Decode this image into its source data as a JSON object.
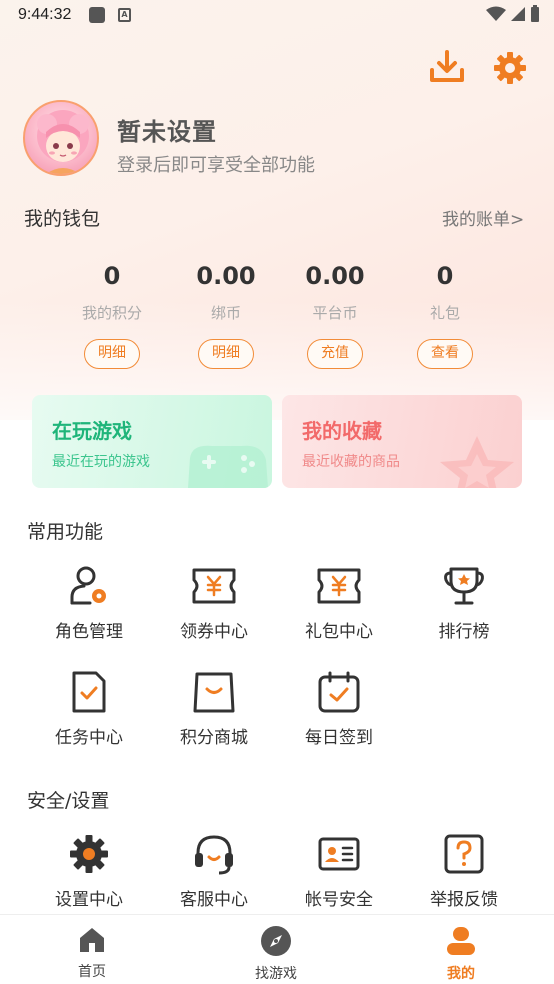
{
  "status_bar": {
    "time": "9:44:32"
  },
  "profile": {
    "name": "暂未设置",
    "subtitle": "登录后即可享受全部功能"
  },
  "wallet": {
    "title": "我的钱包",
    "link": "我的账单>",
    "items": [
      {
        "value": "0",
        "label": "我的积分",
        "button": "明细"
      },
      {
        "value": "0.00",
        "label": "绑币",
        "button": "明细"
      },
      {
        "value": "0.00",
        "label": "平台币",
        "button": "充值"
      },
      {
        "value": "0",
        "label": "礼包",
        "button": "查看"
      }
    ]
  },
  "cards": [
    {
      "title": "在玩游戏",
      "subtitle": "最近在玩的游戏"
    },
    {
      "title": "我的收藏",
      "subtitle": "最近收藏的商品"
    }
  ],
  "common": {
    "title": "常用功能",
    "items": [
      {
        "label": "角色管理",
        "icon": "role-manage-icon"
      },
      {
        "label": "领券中心",
        "icon": "coupon-icon"
      },
      {
        "label": "礼包中心",
        "icon": "gift-ticket-icon"
      },
      {
        "label": "排行榜",
        "icon": "trophy-icon"
      },
      {
        "label": "任务中心",
        "icon": "task-icon"
      },
      {
        "label": "积分商城",
        "icon": "shopping-bag-icon"
      },
      {
        "label": "每日签到",
        "icon": "calendar-check-icon"
      }
    ]
  },
  "security": {
    "title": "安全/设置",
    "items": [
      {
        "label": "设置中心",
        "icon": "gear-icon"
      },
      {
        "label": "客服中心",
        "icon": "headset-icon"
      },
      {
        "label": "帐号安全",
        "icon": "id-card-icon"
      },
      {
        "label": "举报反馈",
        "icon": "question-icon"
      }
    ]
  },
  "nav": {
    "items": [
      {
        "label": "首页",
        "icon": "home-icon"
      },
      {
        "label": "找游戏",
        "icon": "compass-icon"
      },
      {
        "label": "我的",
        "icon": "person-icon"
      }
    ],
    "active_index": 2
  },
  "colors": {
    "accent": "#ef7d22",
    "text": "#333333",
    "green": "#1fb57a",
    "pink": "#f26a6a"
  }
}
